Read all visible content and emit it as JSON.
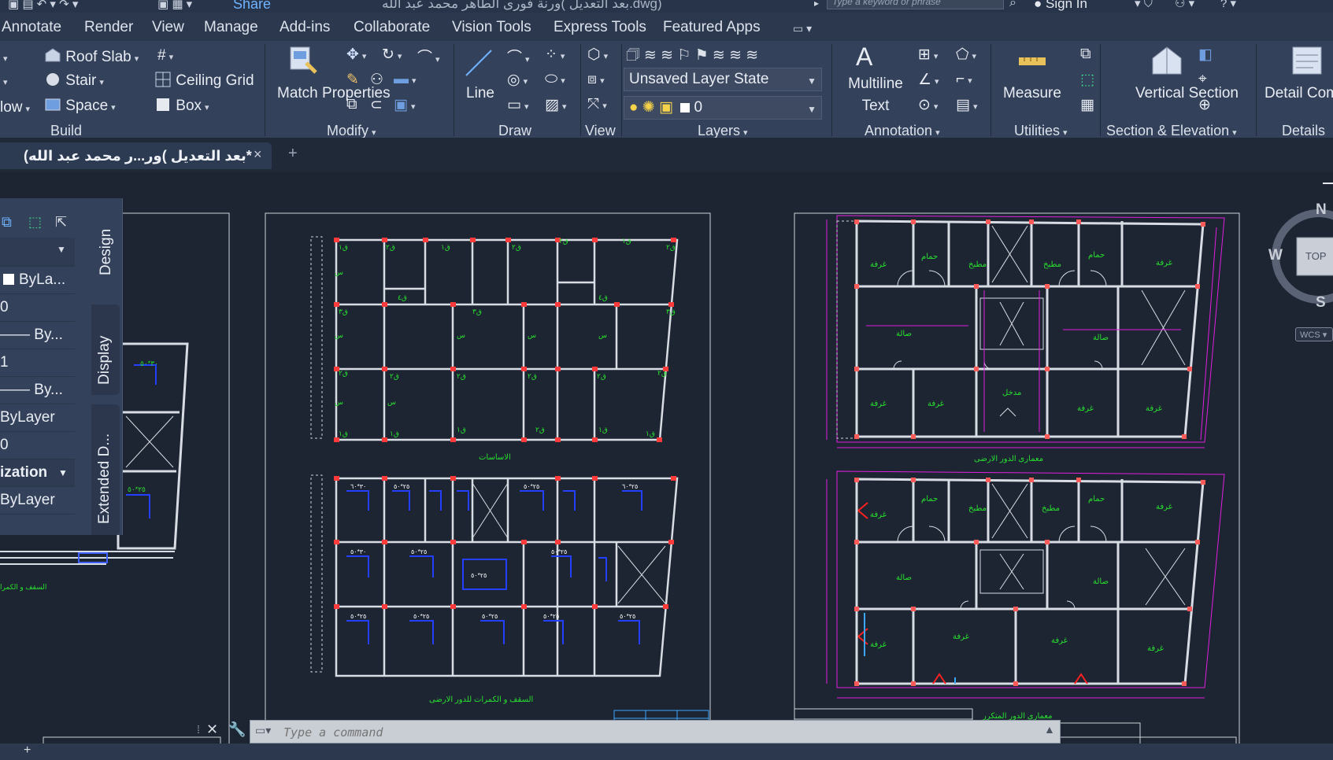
{
  "app": {
    "document_title": "بعد التعديل )ورنة فورى الطاهر محمد عبد الله.dwg)",
    "share_label": "Share",
    "search_placeholder": "Type a keyword or phrase",
    "sign_in_label": "Sign In"
  },
  "ribbon_tabs": [
    "Annotate",
    "Render",
    "View",
    "Manage",
    "Add-ins",
    "Collaborate",
    "Vision Tools",
    "Express Tools",
    "Featured Apps"
  ],
  "ribbon": {
    "build": {
      "title": "Build",
      "roof_slab": "Roof Slab",
      "stair": "Stair",
      "space": "Space",
      "ceiling_grid": "Ceiling Grid",
      "box": "Box",
      "partial_label": "low"
    },
    "modify": {
      "title": "Modify",
      "match_properties": "Match Properties"
    },
    "draw": {
      "title": "Draw",
      "line": "Line"
    },
    "view": {
      "title": "View"
    },
    "layers": {
      "title": "Layers",
      "layer_state": "Unsaved Layer State",
      "current_layer": "0"
    },
    "annotation": {
      "title": "Annotation",
      "multiline_text": "Multiline Text"
    },
    "utilities": {
      "title": "Utilities",
      "measure": "Measure"
    },
    "section_elevation": {
      "title": "Section & Elevation",
      "vertical_section": "Vertical Section"
    },
    "details": {
      "title": "Details",
      "detail_components": "Detail Components"
    }
  },
  "document_tab": {
    "label": "*بعد التعديل )ور...ر محمد عبد الله)",
    "close": "×",
    "new_tab": "+"
  },
  "properties_palette": {
    "rows": [
      "ByLa...",
      "0",
      "—— By...",
      "1",
      "—— By...",
      "ByLayer",
      "0",
      "ization",
      "ByLayer"
    ],
    "vertical_tabs": [
      "Design",
      "Display",
      "Extended D..."
    ]
  },
  "viewcube": {
    "north": "N",
    "south": "S",
    "west": "W",
    "face": "TOP",
    "wcs": "WCS"
  },
  "drawing_labels": {
    "foundations": "الاساسات",
    "roof_beams_ground": "السقف و الكمرات للدور الارضى",
    "arch_ground": "معمارى الدور الارضى",
    "arch_repeat": "معمارى الدور المتكرر",
    "roof_partial": "السقف و الكمرا",
    "room": "غرفة",
    "hall": "صالة",
    "bath": "حمام",
    "kitchen": "مطبخ",
    "entrance": "مدخل"
  },
  "command_line": {
    "placeholder": "Type a command"
  },
  "colors": {
    "background": "#1d2533",
    "ribbon": "#34415a",
    "accent_green": "#28e02e",
    "accent_magenta": "#e020e0",
    "wall": "#cfd3da"
  }
}
